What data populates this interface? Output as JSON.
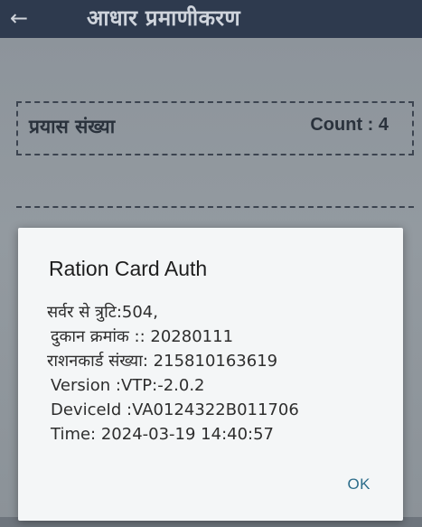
{
  "appbar": {
    "back_icon": "←",
    "title": "आधार प्रमाणीकरण"
  },
  "attempt": {
    "label": "प्रयास संख्या",
    "count": "Count : 4"
  },
  "dialog": {
    "title": "Ration Card Auth",
    "lines": [
      "सर्वर से त्रुटि:504,",
      "दुकान क्रमांक :: 20280111",
      "राशनकार्ड संख्या: 215810163619",
      "Version :VTP:-2.0.2",
      "DeviceId :VA0124322B011706",
      "Time: 2024-03-19 14:40:57"
    ],
    "ok_label": "OK"
  }
}
